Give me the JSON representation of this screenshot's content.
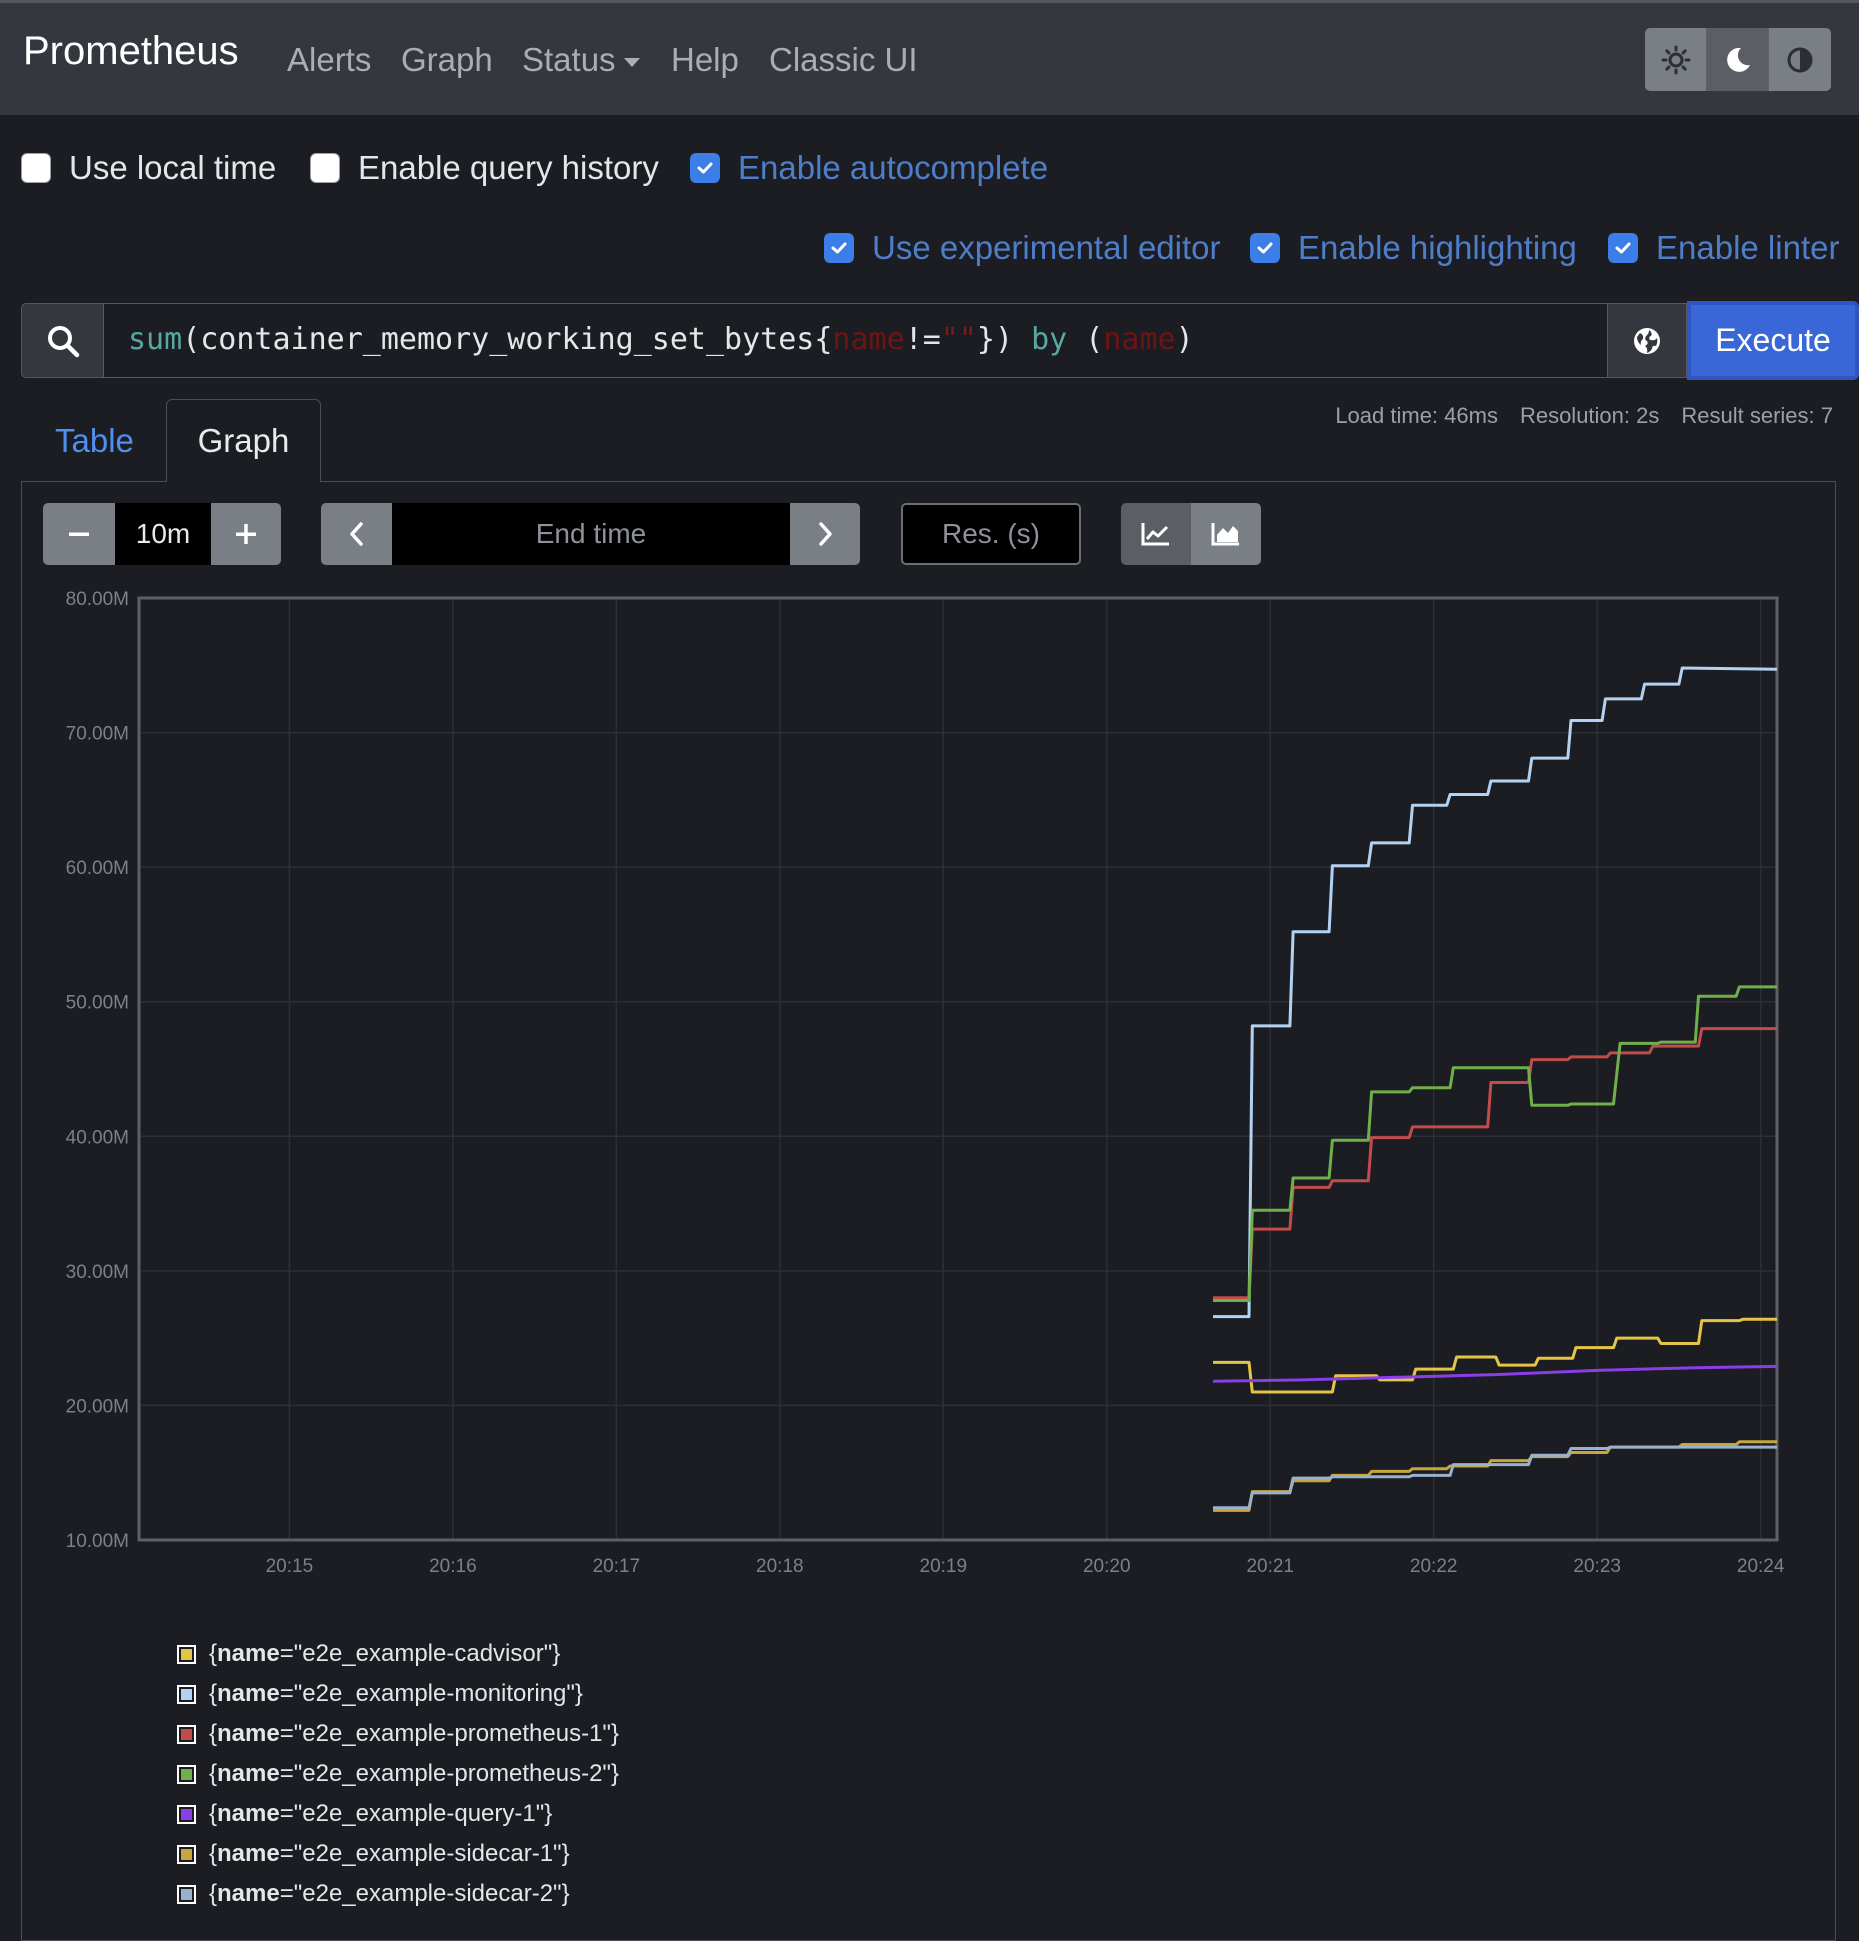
{
  "navbar": {
    "brand": "Prometheus",
    "items": [
      "Alerts",
      "Graph",
      "Status",
      "Help",
      "Classic UI"
    ],
    "theme_buttons": [
      "sun-icon",
      "moon-icon",
      "contrast-icon"
    ]
  },
  "options": {
    "local_time": {
      "label": "Use local time",
      "checked": false
    },
    "query_history": {
      "label": "Enable query history",
      "checked": false
    },
    "autocomplete": {
      "label": "Enable autocomplete",
      "checked": true
    },
    "experimental_editor": {
      "label": "Use experimental editor",
      "checked": true
    },
    "highlighting": {
      "label": "Enable highlighting",
      "checked": true
    },
    "linter": {
      "label": "Enable linter",
      "checked": true
    }
  },
  "query": {
    "fn": "sum",
    "p1": "(container_memory_working_set_bytes{",
    "label1": "name",
    "op": "!=",
    "str": "\"\"",
    "p2": "}) ",
    "kw": "by",
    "p3": " (",
    "label2": "name",
    "p4": ")",
    "execute_label": "Execute"
  },
  "tabs": {
    "table": "Table",
    "graph": "Graph"
  },
  "stats": {
    "load_time": "Load time: 46ms",
    "resolution": "Resolution: 2s",
    "result_series": "Result series: 7"
  },
  "controls": {
    "range": "10m",
    "end_time_placeholder": "End time",
    "res_placeholder": "Res. (s)"
  },
  "colors": {
    "accent": "#3967d8",
    "cadvisor": "#e5c545",
    "monitoring": "#b3d2f2",
    "prometheus1": "#c24b4b",
    "prometheus2": "#6fb04b",
    "query1": "#8a3ee6",
    "sidecar1": "#c7a63e",
    "sidecar2": "#98b2ce"
  },
  "chart_data": {
    "type": "line",
    "y_tick_labels": [
      "80.00M",
      "70.00M",
      "60.00M",
      "50.00M",
      "40.00M",
      "30.00M",
      "20.00M",
      "10.00M"
    ],
    "ylim": [
      10,
      80
    ],
    "y_unit": "M",
    "x_tick_labels": [
      "20:15",
      "20:16",
      "20:17",
      "20:18",
      "20:19",
      "20:20",
      "20:21",
      "20:22",
      "20:23",
      "20:24"
    ],
    "x_unit": "minutes after 20:15",
    "xlim": [
      -0.92,
      9.1
    ],
    "grid": true,
    "legend_placement": "bottom",
    "series": [
      {
        "name": "{name=\"e2e_example-cadvisor\"}",
        "label_key": "name",
        "label_value": "\"e2e_example-cadvisor\"",
        "color": "#e5c545",
        "points": [
          [
            5.65,
            23.2
          ],
          [
            5.87,
            23.2
          ],
          [
            5.89,
            21.0
          ],
          [
            6.0,
            21.0
          ],
          [
            6.15,
            21.0
          ],
          [
            6.38,
            21.0
          ],
          [
            6.4,
            22.2
          ],
          [
            6.65,
            22.2
          ],
          [
            6.67,
            21.9
          ],
          [
            6.87,
            21.9
          ],
          [
            6.89,
            22.7
          ],
          [
            7.12,
            22.7
          ],
          [
            7.14,
            23.6
          ],
          [
            7.38,
            23.6
          ],
          [
            7.4,
            23.0
          ],
          [
            7.62,
            23.0
          ],
          [
            7.64,
            23.5
          ],
          [
            7.85,
            23.5
          ],
          [
            7.87,
            24.3
          ],
          [
            8.1,
            24.3
          ],
          [
            8.12,
            25.0
          ],
          [
            8.37,
            25.0
          ],
          [
            8.39,
            24.6
          ],
          [
            8.62,
            24.6
          ],
          [
            8.64,
            26.3
          ],
          [
            8.87,
            26.3
          ],
          [
            8.89,
            26.4
          ],
          [
            9.1,
            26.4
          ]
        ]
      },
      {
        "name": "{name=\"e2e_example-monitoring\"}",
        "label_key": "name",
        "label_value": "\"e2e_example-monitoring\"",
        "color": "#b3d2f2",
        "points": [
          [
            5.65,
            26.6
          ],
          [
            5.87,
            26.6
          ],
          [
            5.89,
            48.2
          ],
          [
            6.12,
            48.2
          ],
          [
            6.14,
            55.2
          ],
          [
            6.36,
            55.2
          ],
          [
            6.38,
            60.1
          ],
          [
            6.6,
            60.1
          ],
          [
            6.62,
            61.8
          ],
          [
            6.85,
            61.8
          ],
          [
            6.87,
            64.6
          ],
          [
            7.08,
            64.6
          ],
          [
            7.1,
            65.4
          ],
          [
            7.33,
            65.4
          ],
          [
            7.35,
            66.4
          ],
          [
            7.58,
            66.4
          ],
          [
            7.6,
            68.1
          ],
          [
            7.82,
            68.1
          ],
          [
            7.84,
            70.9
          ],
          [
            8.03,
            70.9
          ],
          [
            8.05,
            72.5
          ],
          [
            8.27,
            72.5
          ],
          [
            8.29,
            73.6
          ],
          [
            8.5,
            73.6
          ],
          [
            8.52,
            74.8
          ],
          [
            9.1,
            74.7
          ]
        ]
      },
      {
        "name": "{name=\"e2e_example-prometheus-1\"}",
        "label_key": "name",
        "label_value": "\"e2e_example-prometheus-1\"",
        "color": "#c24b4b",
        "points": [
          [
            5.65,
            28.0
          ],
          [
            5.87,
            28.0
          ],
          [
            5.89,
            33.1
          ],
          [
            6.12,
            33.1
          ],
          [
            6.14,
            36.2
          ],
          [
            6.36,
            36.2
          ],
          [
            6.38,
            36.7
          ],
          [
            6.6,
            36.7
          ],
          [
            6.62,
            39.9
          ],
          [
            6.85,
            39.9
          ],
          [
            6.87,
            40.7
          ],
          [
            7.33,
            40.7
          ],
          [
            7.35,
            44.0
          ],
          [
            7.58,
            44.0
          ],
          [
            7.6,
            45.7
          ],
          [
            7.82,
            45.7
          ],
          [
            7.84,
            45.9
          ],
          [
            8.06,
            45.9
          ],
          [
            8.08,
            46.2
          ],
          [
            8.32,
            46.2
          ],
          [
            8.34,
            46.7
          ],
          [
            8.62,
            46.7
          ],
          [
            8.64,
            48.0
          ],
          [
            9.1,
            48.0
          ]
        ]
      },
      {
        "name": "{name=\"e2e_example-prometheus-2\"}",
        "label_key": "name",
        "label_value": "\"e2e_example-prometheus-2\"",
        "color": "#6fb04b",
        "points": [
          [
            5.65,
            27.8
          ],
          [
            5.87,
            27.8
          ],
          [
            5.89,
            34.5
          ],
          [
            6.12,
            34.5
          ],
          [
            6.14,
            36.9
          ],
          [
            6.36,
            36.9
          ],
          [
            6.38,
            39.7
          ],
          [
            6.6,
            39.7
          ],
          [
            6.62,
            43.3
          ],
          [
            6.85,
            43.3
          ],
          [
            6.87,
            43.6
          ],
          [
            7.1,
            43.6
          ],
          [
            7.12,
            45.1
          ],
          [
            7.58,
            45.1
          ],
          [
            7.6,
            42.3
          ],
          [
            7.82,
            42.3
          ],
          [
            7.84,
            42.4
          ],
          [
            8.1,
            42.4
          ],
          [
            8.14,
            46.9
          ],
          [
            8.37,
            46.9
          ],
          [
            8.39,
            47.0
          ],
          [
            8.6,
            47.0
          ],
          [
            8.62,
            50.4
          ],
          [
            8.85,
            50.4
          ],
          [
            8.87,
            51.1
          ],
          [
            9.1,
            51.1
          ]
        ]
      },
      {
        "name": "{name=\"e2e_example-query-1\"}",
        "label_key": "name",
        "label_value": "\"e2e_example-query-1\"",
        "color": "#8a3ee6",
        "points": [
          [
            5.65,
            21.8
          ],
          [
            6.2,
            21.9
          ],
          [
            6.8,
            22.1
          ],
          [
            7.4,
            22.3
          ],
          [
            8.0,
            22.6
          ],
          [
            8.6,
            22.8
          ],
          [
            9.1,
            22.9
          ]
        ]
      },
      {
        "name": "{name=\"e2e_example-sidecar-1\"}",
        "label_key": "name",
        "label_value": "\"e2e_example-sidecar-1\"",
        "color": "#c7a63e",
        "points": [
          [
            5.65,
            12.2
          ],
          [
            5.87,
            12.2
          ],
          [
            5.89,
            13.6
          ],
          [
            6.12,
            13.6
          ],
          [
            6.14,
            14.4
          ],
          [
            6.36,
            14.4
          ],
          [
            6.38,
            14.8
          ],
          [
            6.6,
            14.8
          ],
          [
            6.62,
            15.1
          ],
          [
            6.85,
            15.1
          ],
          [
            6.87,
            15.3
          ],
          [
            7.08,
            15.3
          ],
          [
            7.1,
            15.5
          ],
          [
            7.33,
            15.5
          ],
          [
            7.35,
            15.9
          ],
          [
            7.58,
            15.9
          ],
          [
            7.6,
            16.2
          ],
          [
            7.82,
            16.2
          ],
          [
            7.84,
            16.5
          ],
          [
            8.06,
            16.5
          ],
          [
            8.08,
            16.9
          ],
          [
            8.5,
            16.9
          ],
          [
            8.52,
            17.1
          ],
          [
            8.85,
            17.1
          ],
          [
            8.87,
            17.3
          ],
          [
            9.1,
            17.3
          ]
        ]
      },
      {
        "name": "{name=\"e2e_example-sidecar-2\"}",
        "label_key": "name",
        "label_value": "\"e2e_example-sidecar-2\"",
        "color": "#98b2ce",
        "points": [
          [
            5.65,
            12.4
          ],
          [
            5.87,
            12.4
          ],
          [
            5.89,
            13.5
          ],
          [
            6.12,
            13.5
          ],
          [
            6.14,
            14.6
          ],
          [
            6.36,
            14.6
          ],
          [
            6.38,
            14.7
          ],
          [
            6.85,
            14.7
          ],
          [
            6.87,
            14.8
          ],
          [
            7.1,
            14.8
          ],
          [
            7.12,
            15.6
          ],
          [
            7.58,
            15.6
          ],
          [
            7.6,
            16.3
          ],
          [
            7.82,
            16.3
          ],
          [
            7.84,
            16.8
          ],
          [
            8.06,
            16.8
          ],
          [
            8.08,
            16.9
          ],
          [
            9.1,
            16.9
          ]
        ]
      }
    ]
  }
}
